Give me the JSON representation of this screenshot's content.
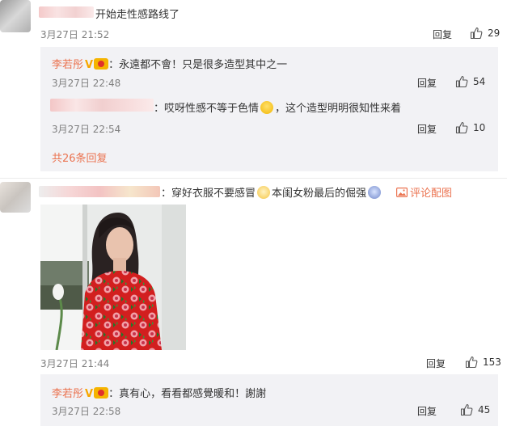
{
  "comments": [
    {
      "text": "开始走性感路线了",
      "time": "3月27日 21:52",
      "reply_label": "回复",
      "likes": "29",
      "sub_replies": [
        {
          "name": "李若彤",
          "text": "：永遠都不會！只是很多造型其中之一",
          "time": "3月27日 22:48",
          "reply_label": "回复",
          "likes": "54"
        },
        {
          "text_a": "：哎呀性感不等于色情",
          "text_b": "，这个造型明明很知性来着",
          "time": "3月27日 22:54",
          "reply_label": "回复",
          "likes": "10"
        }
      ],
      "more_replies": "共26条回复"
    },
    {
      "text_a": "：穿好衣服不要感冒",
      "text_b": "本闺女粉最后的倔强",
      "picture_comment_label": "评论配图",
      "time": "3月27日 21:44",
      "reply_label": "回复",
      "likes": "153",
      "sub_replies": [
        {
          "name": "李若彤",
          "text": "：真有心，看看都感覺暖和！謝謝",
          "time": "3月27日 22:58",
          "reply_label": "回复",
          "likes": "45"
        }
      ]
    }
  ],
  "icons": {
    "like": "thumbs-up-icon",
    "picture": "picture-icon",
    "verified": "verified-v-icon",
    "level": "level-badge-icon"
  },
  "colors": {
    "name": "#eb7350",
    "reply_bg": "#f2f2f5",
    "text": "#333333",
    "time": "#808080"
  }
}
